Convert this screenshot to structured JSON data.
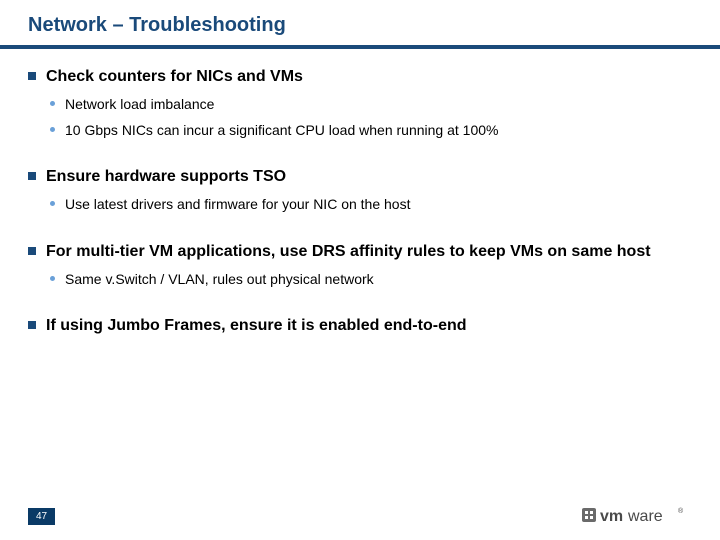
{
  "title": "Network – Troubleshooting",
  "sections": [
    {
      "heading": "Check counters for NICs and VMs",
      "subs": [
        "Network load imbalance",
        "10 Gbps NICs can incur a significant CPU load when running at 100%"
      ]
    },
    {
      "heading": "Ensure hardware supports TSO",
      "subs": [
        "Use latest drivers and firmware for your NIC on the host"
      ]
    },
    {
      "heading": "For multi-tier VM applications, use DRS affinity rules to keep VMs on same host",
      "subs": [
        "Same v.Switch / VLAN, rules out physical network"
      ]
    },
    {
      "heading": "If using Jumbo Frames, ensure it is enabled end-to-end",
      "subs": []
    }
  ],
  "page_number": "47",
  "logo_text": "vmware"
}
